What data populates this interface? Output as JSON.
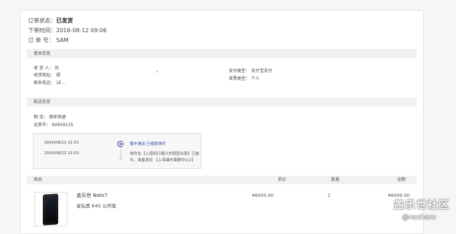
{
  "order": {
    "status_label": "订单状态：",
    "status_value": "已发货",
    "time_label": "下单时间：",
    "time_value": "2016-08-12 09:06",
    "number_label": "订 单 号：",
    "number_value": "SAM"
  },
  "basic_info": {
    "section_title": "基本信息",
    "receiver_label": "收 货 人：",
    "receiver_value": "刘",
    "address_label": "收货地址：",
    "address_value": "绿",
    "phone_label": "联系电话：",
    "phone_value": "1E...",
    "pay_type_label": "支付类型：",
    "pay_type_value": "支付宝支付",
    "invoice_label": "发票类型：",
    "invoice_value": "个人",
    "mark": "\""
  },
  "shipping": {
    "section_title": "配送信息",
    "carrier_label": "物    流：",
    "carrier_value": "顺丰快递",
    "waybill_label": "运单号：",
    "waybill_value": "60659135",
    "timeline": [
      {
        "time": "2016/08/12 21:53",
        "text": "顺丰速运 已收取快件",
        "active": true
      },
      {
        "time": "2016/08/12 21:53",
        "text": "快件在【上海闵行顺兴东翔营业部】已装车，准备发往 【上海浦东集散中心2】",
        "active": false
      }
    ]
  },
  "products": {
    "headers": {
      "product": "商品",
      "price": "单价",
      "qty": "数量",
      "amount": "金额"
    },
    "items": [
      {
        "name": "盖乐世 Note7",
        "spec": "星钻黑  64G  公开版",
        "price": "¥6000.00",
        "qty": "1",
        "amount": "¥6000.00"
      }
    ]
  },
  "watermark": {
    "main": "盖乐世社区",
    "sub": "@rexhero"
  }
}
